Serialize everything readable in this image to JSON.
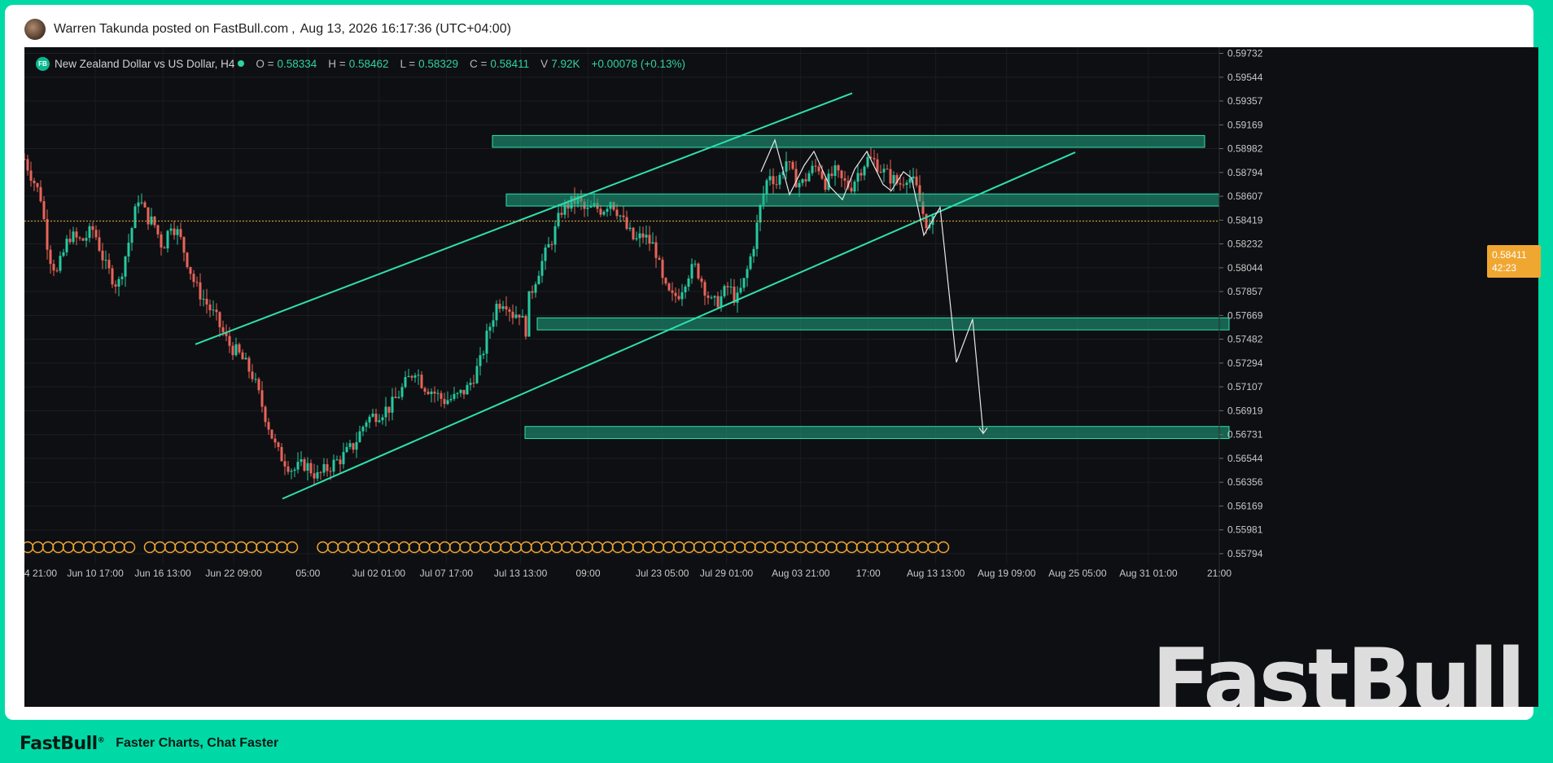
{
  "post": {
    "author": "Warren Takunda",
    "posted_on": "posted on FastBull.com",
    "separator": ",",
    "datetime": "Aug 13, 2026 16:17:36 (UTC+04:00)"
  },
  "legend": {
    "symbol": "New Zealand Dollar vs US Dollar, H4",
    "logo_text": "FB",
    "open_label": "O =",
    "open": "0.58334",
    "high_label": "H =",
    "high": "0.58462",
    "low_label": "L =",
    "low": "0.58329",
    "close_label": "C =",
    "close": "0.58411",
    "volume_label": "V",
    "volume": "7.92K",
    "change": "+0.00078 (+0.13%)"
  },
  "price_tag": {
    "price": "0.58411",
    "countdown": "42:23"
  },
  "watermark": "FastBull",
  "footer": {
    "logo": "FastBull",
    "slogan": "Faster Charts, Chat Faster"
  },
  "colors": {
    "background": "#0e0f12",
    "up": "#26c9a0",
    "down": "#e8645a",
    "zone_fill": "#1fa883",
    "zone_stroke": "#2ee0b0",
    "trendline": "#2ee0b0",
    "projection": "#e8e8e8",
    "current_price": "#f0a732",
    "event_marker": "#f0a732",
    "axis_text": "#c8c8c8"
  },
  "chart_data": {
    "type": "candlestick",
    "symbol": "NZDUSD",
    "timeframe": "H4",
    "ylim": [
      0.5571,
      0.5978
    ],
    "y_ticks": [
      0.59732,
      0.59544,
      0.59357,
      0.59169,
      0.58982,
      0.58794,
      0.58607,
      0.58419,
      0.58232,
      0.58044,
      0.57857,
      0.57669,
      0.57482,
      0.57294,
      0.57107,
      0.56919,
      0.56731,
      0.56544,
      0.56356,
      0.56169,
      0.55981,
      0.55794
    ],
    "x_ticks": [
      "4 21:00",
      "Jun 10 17:00",
      "Jun 16 13:00",
      "Jun 22 09:00",
      "05:00",
      "Jul 02 01:00",
      "Jul 07 17:00",
      "Jul 13 13:00",
      "09:00",
      "Jul 23 05:00",
      "Jul 29 01:00",
      "Aug 03 21:00",
      "17:00",
      "Aug 13 13:00",
      "Aug 19 09:00",
      "Aug 25 05:00",
      "Aug 31 01:00",
      "21:00"
    ],
    "current_price": 0.58411,
    "price_path": [
      [
        0,
        0.589
      ],
      [
        10,
        0.5875
      ],
      [
        20,
        0.586
      ],
      [
        30,
        0.5815
      ],
      [
        40,
        0.58
      ],
      [
        55,
        0.583
      ],
      [
        70,
        0.5825
      ],
      [
        85,
        0.5835
      ],
      [
        100,
        0.5805
      ],
      [
        115,
        0.579
      ],
      [
        130,
        0.583
      ],
      [
        140,
        0.586
      ],
      [
        150,
        0.5845
      ],
      [
        160,
        0.5838
      ],
      [
        170,
        0.582
      ],
      [
        180,
        0.584
      ],
      [
        190,
        0.583
      ],
      [
        200,
        0.581
      ],
      [
        210,
        0.579
      ],
      [
        220,
        0.578
      ],
      [
        235,
        0.5765
      ],
      [
        250,
        0.5745
      ],
      [
        265,
        0.5735
      ],
      [
        280,
        0.572
      ],
      [
        295,
        0.569
      ],
      [
        310,
        0.566
      ],
      [
        330,
        0.5645
      ],
      [
        345,
        0.565
      ],
      [
        360,
        0.564
      ],
      [
        375,
        0.5648
      ],
      [
        390,
        0.5655
      ],
      [
        405,
        0.5665
      ],
      [
        420,
        0.5685
      ],
      [
        435,
        0.569
      ],
      [
        450,
        0.5695
      ],
      [
        465,
        0.571
      ],
      [
        480,
        0.5725
      ],
      [
        490,
        0.5712
      ],
      [
        500,
        0.5708
      ],
      [
        515,
        0.57
      ],
      [
        530,
        0.5702
      ],
      [
        545,
        0.571
      ],
      [
        560,
        0.573
      ],
      [
        570,
        0.5755
      ],
      [
        580,
        0.5775
      ],
      [
        590,
        0.578
      ],
      [
        600,
        0.5768
      ],
      [
        610,
        0.577
      ],
      [
        615,
        0.575
      ],
      [
        620,
        0.578
      ],
      [
        630,
        0.58
      ],
      [
        640,
        0.5815
      ],
      [
        650,
        0.583
      ],
      [
        660,
        0.585
      ],
      [
        670,
        0.5855
      ],
      [
        680,
        0.5858
      ],
      [
        690,
        0.5848
      ],
      [
        700,
        0.5852
      ],
      [
        710,
        0.585
      ],
      [
        720,
        0.5858
      ],
      [
        730,
        0.5848
      ],
      [
        740,
        0.5835
      ],
      [
        750,
        0.5825
      ],
      [
        760,
        0.583
      ],
      [
        775,
        0.582
      ],
      [
        785,
        0.579
      ],
      [
        795,
        0.578
      ],
      [
        805,
        0.5785
      ],
      [
        815,
        0.58
      ],
      [
        825,
        0.5805
      ],
      [
        835,
        0.579
      ],
      [
        845,
        0.5775
      ],
      [
        855,
        0.578
      ],
      [
        865,
        0.579
      ],
      [
        875,
        0.5778
      ],
      [
        885,
        0.5795
      ],
      [
        895,
        0.582
      ],
      [
        905,
        0.5855
      ],
      [
        915,
        0.588
      ],
      [
        925,
        0.587
      ],
      [
        935,
        0.589
      ],
      [
        945,
        0.5875
      ],
      [
        955,
        0.587
      ],
      [
        965,
        0.588
      ],
      [
        975,
        0.5885
      ],
      [
        985,
        0.587
      ],
      [
        995,
        0.588
      ],
      [
        1005,
        0.5872
      ],
      [
        1015,
        0.5868
      ],
      [
        1025,
        0.588
      ],
      [
        1035,
        0.589
      ],
      [
        1045,
        0.5888
      ],
      [
        1055,
        0.588
      ],
      [
        1065,
        0.5875
      ],
      [
        1075,
        0.587
      ],
      [
        1085,
        0.5878
      ],
      [
        1095,
        0.5868
      ],
      [
        1105,
        0.5845
      ],
      [
        1112,
        0.5835
      ],
      [
        1118,
        0.5842
      ]
    ],
    "zones": [
      {
        "x_from": 575,
        "x_to": 1450,
        "y_from": 0.58992,
        "y_to": 0.59085
      },
      {
        "x_from": 592,
        "x_to": 1468,
        "y_from": 0.5853,
        "y_to": 0.58625
      },
      {
        "x_from": 630,
        "x_to": 1480,
        "y_from": 0.57555,
        "y_to": 0.5765
      },
      {
        "x_from": 615,
        "x_to": 1480,
        "y_from": 0.567,
        "y_to": 0.56795
      }
    ],
    "trendlines": [
      {
        "from": [
          210,
          0.57442
        ],
        "to": [
          1017,
          0.59418
        ]
      },
      {
        "from": [
          317,
          0.56226
        ],
        "to": [
          1291,
          0.58953
        ]
      }
    ],
    "projection_path": [
      [
        905,
        0.588
      ],
      [
        922,
        0.5905
      ],
      [
        940,
        0.5862
      ],
      [
        958,
        0.5885
      ],
      [
        970,
        0.5896
      ],
      [
        990,
        0.5868
      ],
      [
        1005,
        0.5858
      ],
      [
        1020,
        0.5882
      ],
      [
        1035,
        0.5896
      ],
      [
        1055,
        0.587
      ],
      [
        1065,
        0.5865
      ],
      [
        1080,
        0.588
      ],
      [
        1090,
        0.5875
      ],
      [
        1105,
        0.583
      ],
      [
        1125,
        0.5852
      ],
      [
        1145,
        0.573
      ],
      [
        1165,
        0.5764
      ],
      [
        1178,
        0.5674
      ]
    ]
  }
}
